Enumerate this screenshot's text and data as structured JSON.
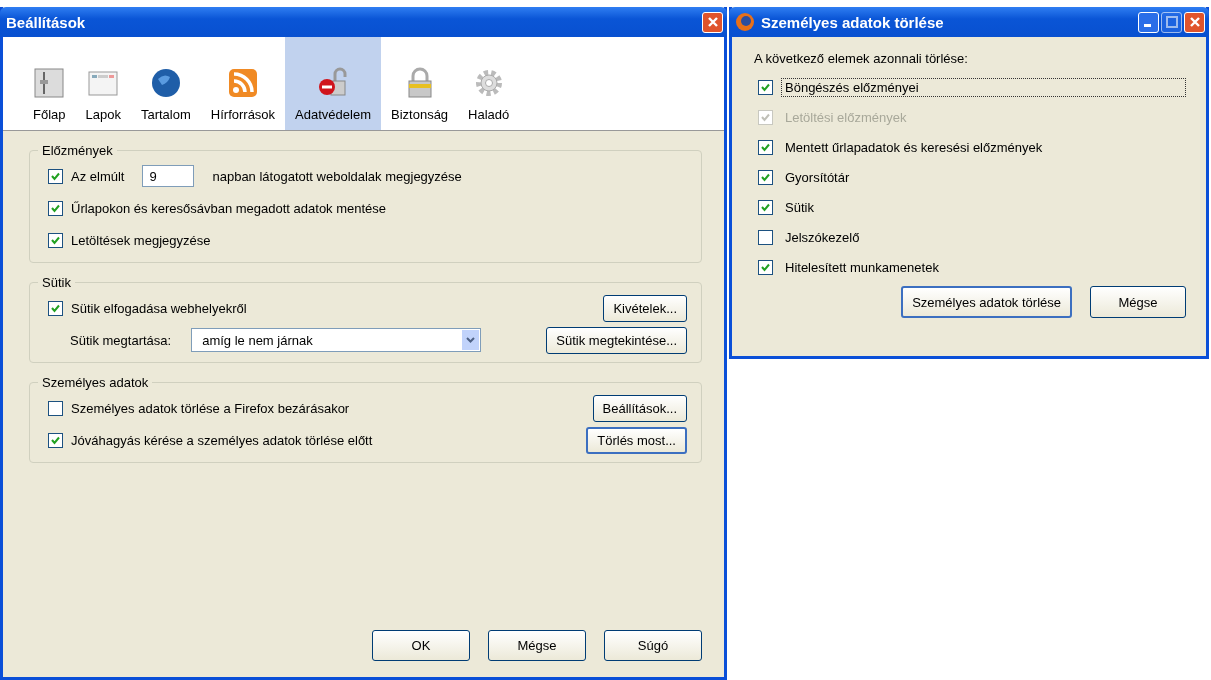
{
  "main_window": {
    "title": "Beállítások",
    "tabs": [
      {
        "label": "Főlap",
        "selected": false
      },
      {
        "label": "Lapok",
        "selected": false
      },
      {
        "label": "Tartalom",
        "selected": false
      },
      {
        "label": "Hírforrások",
        "selected": false
      },
      {
        "label": "Adatvédelem",
        "selected": true
      },
      {
        "label": "Biztonság",
        "selected": false
      },
      {
        "label": "Haladó",
        "selected": false
      }
    ],
    "groups": [
      {
        "legend": "Előzmények",
        "rows": [
          {
            "kind": "days",
            "checked": true,
            "label": "Az elmúlt",
            "value": "9",
            "suffix": "napban látogatott weboldalak megjegyzése"
          },
          {
            "kind": "check",
            "checked": true,
            "label": "Űrlapokon és keresősávban megadott adatok mentése"
          },
          {
            "kind": "check",
            "checked": true,
            "label": "Letöltések megjegyzése"
          }
        ]
      },
      {
        "legend": "Sütik",
        "rows": [
          {
            "kind": "check",
            "checked": true,
            "label": "Sütik elfogadása webhelyekről",
            "button": {
              "label": "Kivételek...",
              "default": false
            }
          },
          {
            "kind": "select",
            "label": "Sütik megtartása:",
            "value": "amíg le nem járnak",
            "button": {
              "label": "Sütik megtekintése...",
              "default": false
            }
          }
        ]
      },
      {
        "legend": "Személyes adatok",
        "rows": [
          {
            "kind": "check",
            "checked": false,
            "label": "Személyes adatok törlése a Firefox bezárásakor",
            "button": {
              "label": "Beállítások...",
              "default": false
            }
          },
          {
            "kind": "check",
            "checked": true,
            "label": "Jóváhagyás kérése a személyes adatok törlése előtt",
            "button": {
              "label": "Törlés most...",
              "default": true
            }
          }
        ]
      }
    ],
    "buttons": [
      {
        "label": "OK",
        "default": false
      },
      {
        "label": "Mégse",
        "default": false
      },
      {
        "label": "Súgó",
        "default": false
      }
    ]
  },
  "dialog": {
    "title": "Személyes adatok törlése",
    "intro": "A következő elemek azonnali törlése:",
    "items": [
      {
        "label": "Böngészés előzményei",
        "checked": true,
        "disabled": false,
        "focused": true
      },
      {
        "label": "Letöltési előzmények",
        "checked": true,
        "disabled": true,
        "focused": false
      },
      {
        "label": "Mentett űrlapadatok és keresési előzmények",
        "checked": true,
        "disabled": false,
        "focused": false
      },
      {
        "label": "Gyorsítótár",
        "checked": true,
        "disabled": false,
        "focused": false
      },
      {
        "label": "Sütik",
        "checked": true,
        "disabled": false,
        "focused": false
      },
      {
        "label": "Jelszókezelő",
        "checked": false,
        "disabled": false,
        "focused": false
      },
      {
        "label": "Hitelesített munkamenetek",
        "checked": true,
        "disabled": false,
        "focused": false
      }
    ],
    "buttons": [
      {
        "label": "Személyes adatok törlése",
        "default": true
      },
      {
        "label": "Mégse",
        "default": false
      }
    ]
  }
}
